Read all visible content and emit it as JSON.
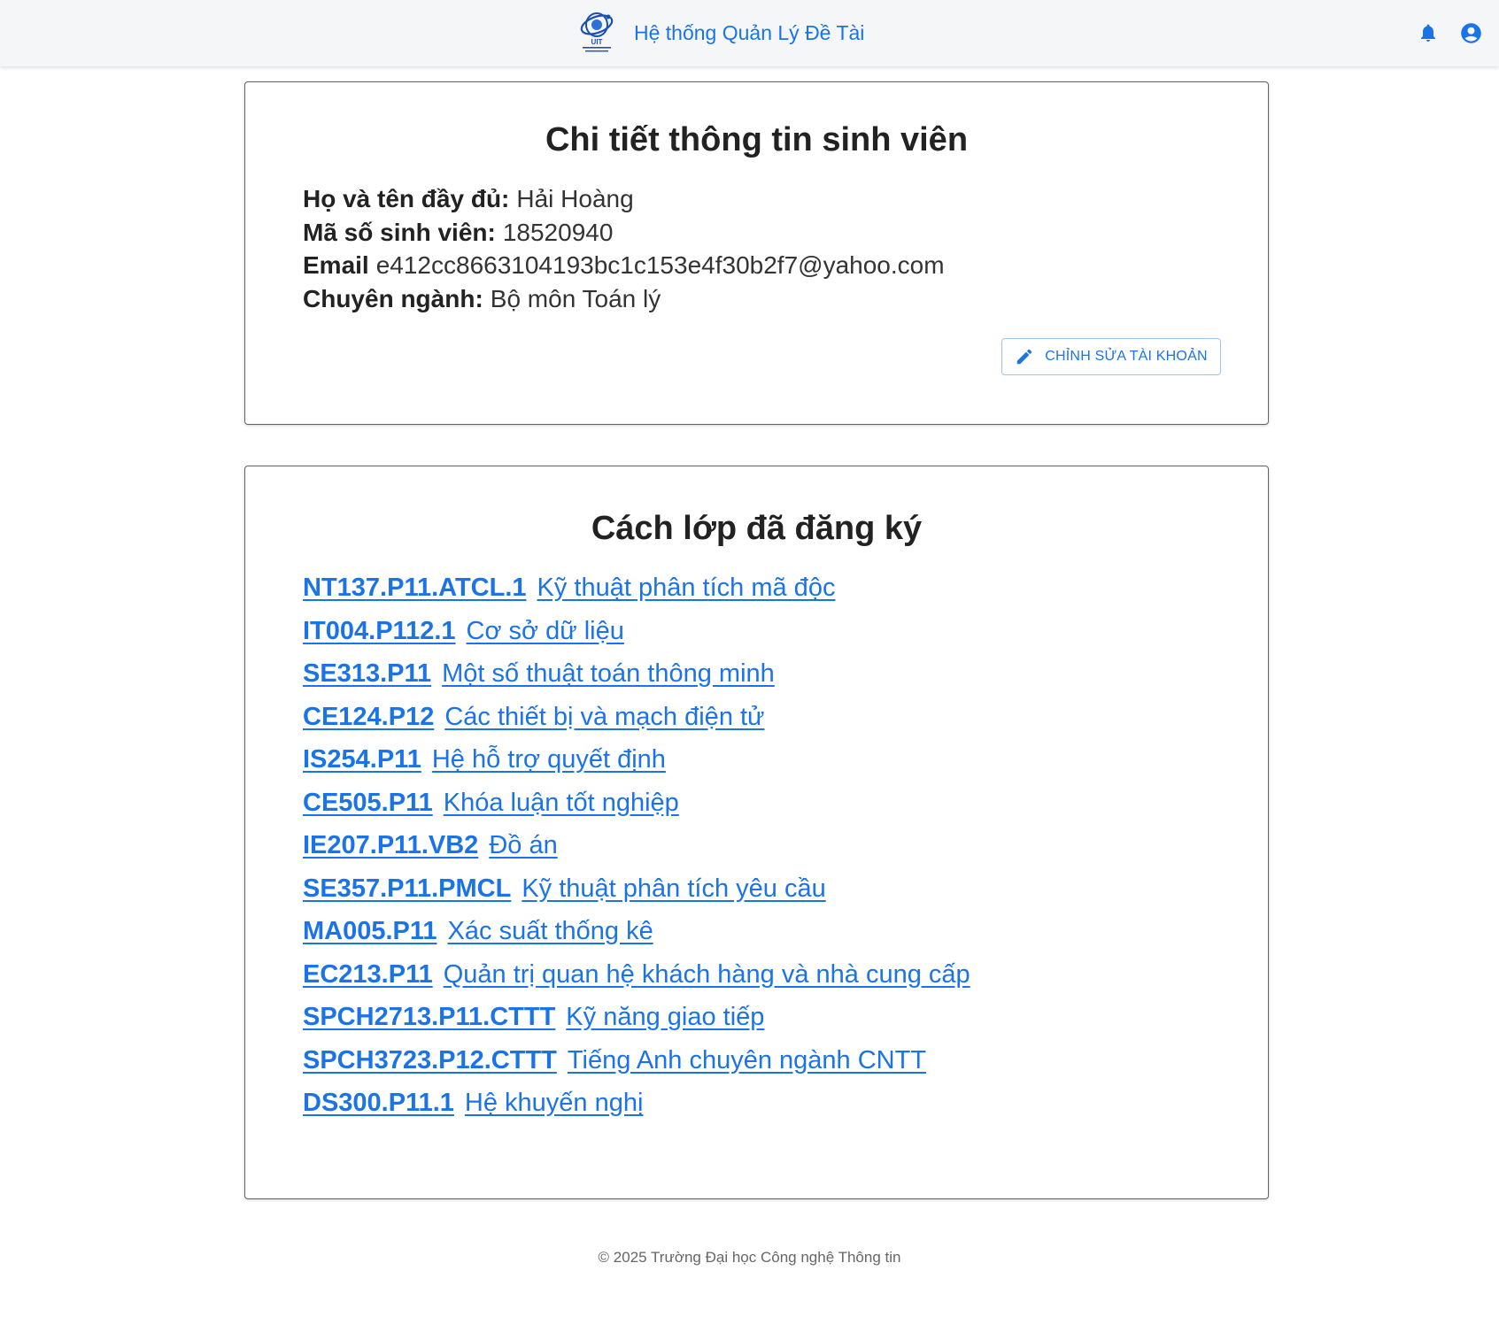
{
  "header": {
    "title": "Hệ thống Quản Lý Đề Tài",
    "logo_text": "UIT",
    "accent_color": "#1a73e8",
    "icons": [
      "notification-bell-icon",
      "account-circle-icon"
    ]
  },
  "student_info": {
    "title": "Chi tiết thông tin sinh viên",
    "fields": [
      {
        "label": "Họ và tên đầy đủ:",
        "value": "Hải Hoàng"
      },
      {
        "label": "Mã số sinh viên:",
        "value": "18520940"
      },
      {
        "label": "Email",
        "value": "e412cc8663104193bc1c153e4f30b2f7@yahoo.com"
      },
      {
        "label": "Chuyên ngành:",
        "value": "Bộ môn Toán lý"
      }
    ],
    "edit_button_label": "CHỈNH SỬA TÀI KHOẢN"
  },
  "classes": {
    "title": "Cách lớp đã đăng ký",
    "items": [
      {
        "code": "NT137.P11.ATCL.1",
        "name": "Kỹ thuật phân tích mã độc"
      },
      {
        "code": "IT004.P112.1",
        "name": "Cơ sở dữ liệu"
      },
      {
        "code": "SE313.P11",
        "name": "Một số thuật toán thông minh"
      },
      {
        "code": "CE124.P12",
        "name": "Các thiết bị và mạch điện tử"
      },
      {
        "code": "IS254.P11",
        "name": "Hệ hỗ trợ quyết định"
      },
      {
        "code": "CE505.P11",
        "name": "Khóa luận tốt nghiệp"
      },
      {
        "code": "IE207.P11.VB2",
        "name": "Đồ án"
      },
      {
        "code": "SE357.P11.PMCL",
        "name": "Kỹ thuật phân tích yêu cầu"
      },
      {
        "code": "MA005.P11",
        "name": "Xác suất thống kê"
      },
      {
        "code": "EC213.P11",
        "name": "Quản trị quan hệ khách hàng và nhà cung cấp"
      },
      {
        "code": "SPCH2713.P11.CTTT",
        "name": "Kỹ năng giao tiếp"
      },
      {
        "code": "SPCH3723.P12.CTTT",
        "name": "Tiếng Anh chuyên ngành CNTT"
      },
      {
        "code": "DS300.P11.1",
        "name": "Hệ khuyến nghị"
      }
    ]
  },
  "footer": {
    "text": "© 2025 Trường Đại học Công nghệ Thông tin"
  }
}
